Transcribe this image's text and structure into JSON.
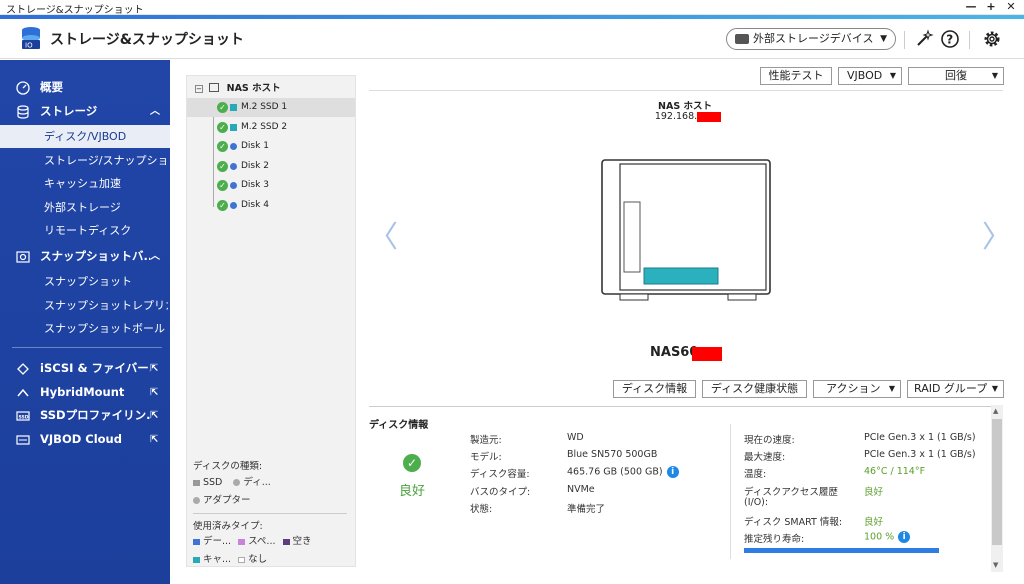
{
  "window": {
    "title": "ストレージ&スナップショット",
    "controls": {
      "min": "—",
      "max": "+",
      "close": "✕"
    }
  },
  "header": {
    "app_title": "ストレージ&スナップショット",
    "external_device_label": "外部ストレージデバイス"
  },
  "sidebar": {
    "overview": "概要",
    "storage": "ストレージ",
    "storage_items": [
      "ディスク/VJBOD",
      "ストレージ/スナップショ",
      "キャッシュ加速",
      "外部ストレージ",
      "リモートディスク"
    ],
    "snapshot_backup": "スナップショットバ...",
    "snapshot_items": [
      "スナップショット",
      "スナップショットレプリカ",
      "スナップショットボールト"
    ],
    "iscsi": "iSCSI & ファイバー...",
    "hybridmount": "HybridMount",
    "ssd_profiling": "SSDプロファイリン...",
    "vjbod_cloud": "VJBOD Cloud"
  },
  "tree": {
    "root": "NAS ホスト",
    "items": [
      {
        "name": "M.2 SSD 1",
        "kind": "ssd"
      },
      {
        "name": "M.2 SSD 2",
        "kind": "ssd"
      },
      {
        "name": "Disk 1",
        "kind": "hdd"
      },
      {
        "name": "Disk 2",
        "kind": "hdd"
      },
      {
        "name": "Disk 3",
        "kind": "hdd"
      },
      {
        "name": "Disk 4",
        "kind": "hdd"
      }
    ],
    "legend": {
      "disk_type_title": "ディスクの種類:",
      "ssd": "SSD",
      "disk": "ディ...",
      "adapter": "アダプター",
      "usage_title": "使用済みタイプ:",
      "data": "デー...",
      "space": "スペ...",
      "free": "空き",
      "cache": "キャ...",
      "none": "なし"
    }
  },
  "toolbar": {
    "perf_test": "性能テスト",
    "vjbod": "VJBOD",
    "recover": "回復"
  },
  "nas": {
    "host_name": "NAS ホスト",
    "ip": "192.168.",
    "model": "NAS60"
  },
  "actions": {
    "disk_info": "ディスク情報",
    "disk_health": "ディスク健康状態",
    "action": "アクション",
    "raid_group": "RAID グループ"
  },
  "disk_info": {
    "title": "ディスク情報",
    "status": "良好",
    "left": [
      {
        "k": "製造元:",
        "v": "WD"
      },
      {
        "k": "モデル:",
        "v": "Blue SN570 500GB"
      },
      {
        "k": "ディスク容量:",
        "v": "465.76 GB (500 GB)"
      },
      {
        "k": "バスのタイプ:",
        "v": "NVMe"
      },
      {
        "k": "状態:",
        "v": "準備完了"
      }
    ],
    "right": [
      {
        "k": "現在の速度:",
        "v": "PCIe Gen.3 x 1 (1 GB/s)"
      },
      {
        "k": "最大速度:",
        "v": "PCIe Gen.3 x 1 (1 GB/s)"
      },
      {
        "k": "温度:",
        "v": "46°C / 114°F"
      },
      {
        "k": "ディスクアクセス履歴",
        "k2": "(I/O):",
        "v": "良好"
      },
      {
        "k": "ディスク SMART 情報:",
        "v": "良好"
      },
      {
        "k": "推定残り寿命:",
        "v": "100 %"
      }
    ],
    "life_percent": 100,
    "info_glyph": "i"
  },
  "colors": {
    "sidebar": "#1c3f9c",
    "ok_green": "#4cae4c",
    "ssd_teal": "#28a9b8"
  }
}
